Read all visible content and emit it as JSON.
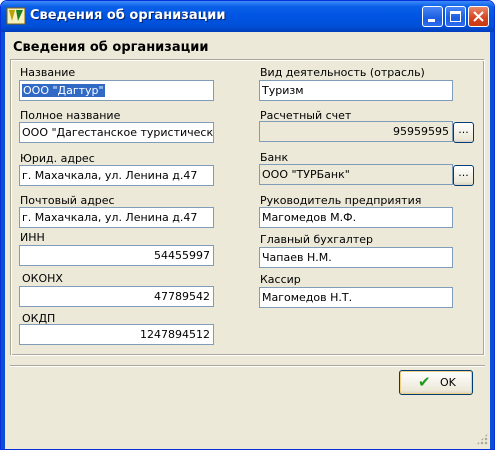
{
  "window": {
    "title": "Сведения об организации"
  },
  "form": {
    "header": "Сведения об организации",
    "left": [
      {
        "label": "Название",
        "value": "ООО \"Дагтур\""
      },
      {
        "label": "Полное название",
        "value": "ООО \"Дагестанское туристическое а"
      },
      {
        "label": "Юрид. адрес",
        "value": "г. Махачкала, ул. Ленина д.47"
      },
      {
        "label": "Почтовый адрес",
        "value": "г. Махачкала, ул. Ленина д.47"
      },
      {
        "label": "ИНН",
        "value": "54455997"
      },
      {
        "label": "ОКОНХ",
        "value": "47789542"
      },
      {
        "label": "ОКДП",
        "value": "1247894512"
      }
    ],
    "right": [
      {
        "label": "Вид деятельность (отрасль)",
        "value": "Туризм"
      },
      {
        "label": "Расчетный счет",
        "value": "95959595"
      },
      {
        "label": "Банк",
        "value": "ООО \"ТУРБанк\""
      },
      {
        "label": "Руководитель предприятия",
        "value": "Магомедов М.Ф."
      },
      {
        "label": "Главный бухгалтер",
        "value": "Чапаев Н.М."
      },
      {
        "label": "Кассир",
        "value": "Магомедов Н.Т."
      }
    ],
    "browse_label": "...",
    "ok_label": "OK"
  }
}
